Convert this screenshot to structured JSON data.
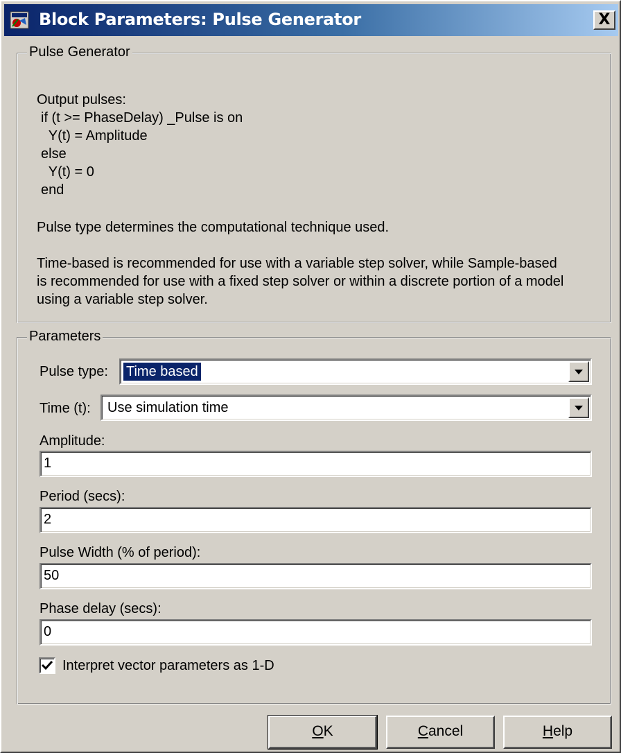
{
  "window": {
    "title": "Block Parameters: Pulse Generator",
    "close_label": "X"
  },
  "description": {
    "group_title": "Pulse Generator",
    "lines": [
      "Output pulses:",
      "if (t >= PhaseDelay) _Pulse is on",
      "  Y(t) = Amplitude",
      "else",
      "  Y(t) = 0",
      "end",
      "Pulse type determines the computational technique used.",
      "Time-based is recommended for use with a variable step solver, while Sample-based",
      "is recommended for use with a fixed step solver or within a discrete portion of a model",
      "using a variable step solver."
    ]
  },
  "parameters": {
    "group_title": "Parameters",
    "pulse_type": {
      "label": "Pulse type:",
      "value": "Time based"
    },
    "time": {
      "label": "Time (t):",
      "value": "Use simulation time"
    },
    "amplitude": {
      "label": "Amplitude:",
      "value": "1"
    },
    "period": {
      "label": "Period (secs):",
      "value": "2"
    },
    "pulse_width": {
      "label": "Pulse Width (% of period):",
      "value": "50"
    },
    "phase_delay": {
      "label": "Phase delay (secs):",
      "value": "0"
    },
    "interpret_vector": {
      "label": "Interpret vector parameters as 1-D",
      "checked": true
    }
  },
  "buttons": {
    "ok": {
      "mnemonic": "O",
      "rest": "K"
    },
    "cancel": {
      "mnemonic": "C",
      "rest": "ancel"
    },
    "help": {
      "mnemonic": "H",
      "rest": "elp"
    }
  }
}
